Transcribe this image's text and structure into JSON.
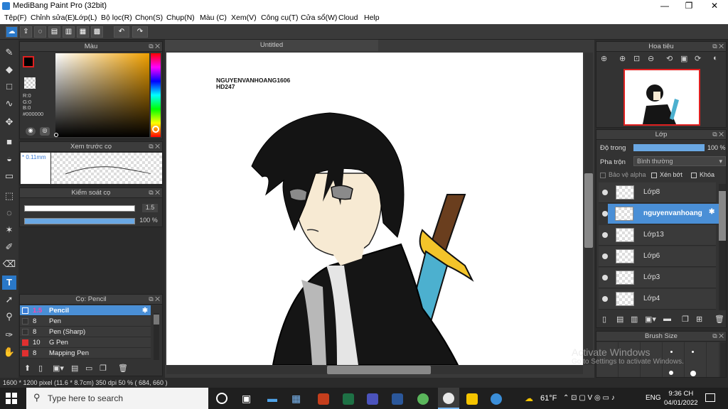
{
  "window": {
    "title": "MediBang Paint Pro (32bit)"
  },
  "menu": [
    "Tệp(F)",
    "Chỉnh sửa(E)",
    "Lớp(L)",
    "Bộ lọc(R)",
    "Chọn(S)",
    "Chụp(N)",
    "Màu (C)",
    "Xem(V)",
    "Công cụ(T)",
    "Cửa sổ(W)",
    "Cloud",
    "Help"
  ],
  "color_panel": {
    "title": "Màu",
    "r": "R:0",
    "g": "G:0",
    "b": "B:0",
    "hex": "#000000"
  },
  "brush_preview": {
    "title": "Xem trước cọ",
    "size": "* 0.11mm"
  },
  "brush_control": {
    "title": "Kiểm soát cọ",
    "size_value": "1.5",
    "opacity_value": "100 %"
  },
  "brush_list": {
    "title": "Cọ: Pencil",
    "items": [
      {
        "size": "1.5",
        "name": "Pencil",
        "color": "#3a7bd5"
      },
      {
        "size": "8",
        "name": "Pen",
        "color": "#333333"
      },
      {
        "size": "8",
        "name": "Pen (Sharp)",
        "color": "#333333"
      },
      {
        "size": "10",
        "name": "G Pen",
        "color": "#e03030"
      },
      {
        "size": "8",
        "name": "Mapping Pen",
        "color": "#e03030"
      }
    ]
  },
  "canvas": {
    "tab": "Untitled",
    "text_line1": "NGUYENVANHOANG1606",
    "text_line2": "HD247"
  },
  "navigator": {
    "title": "Hoa tiêu"
  },
  "layer_panel": {
    "title": "Lớp",
    "opacity_label": "Độ trong",
    "opacity_value": "100 %",
    "blend_label": "Pha trộn",
    "blend_value": "Bình thường",
    "protect_alpha": "Bảo vệ alpha",
    "clip": "Xén bớt",
    "lock": "Khóa",
    "layers": [
      "Lớp8",
      "nguyenvanhoang",
      "Lớp13",
      "Lớp6",
      "Lớp3",
      "Lớp4"
    ]
  },
  "brush_size": {
    "title": "Brush Size"
  },
  "watermark": {
    "line1": "Activate Windows",
    "line2": "Go to Settings to activate Windows."
  },
  "status": {
    "text": "1600 * 1200 pixel   (11.6 * 8.7cm)   350 dpi   50 %   ( 684, 660 )"
  },
  "taskbar": {
    "search_placeholder": "Type here to search",
    "weather": "61°F",
    "lang": "ENG",
    "time": "9:36 CH",
    "date": "04/01/2022",
    "app_colors": [
      "#c43e1c",
      "#1e7145",
      "#4b53bc",
      "#2b579a",
      "#5ab55b",
      "#e8e8e8",
      "#f5c400",
      "#3b8ed8"
    ]
  },
  "colors": {
    "accent": "#4a8fd6",
    "panel": "#333333",
    "selected": "#2a78c8"
  }
}
